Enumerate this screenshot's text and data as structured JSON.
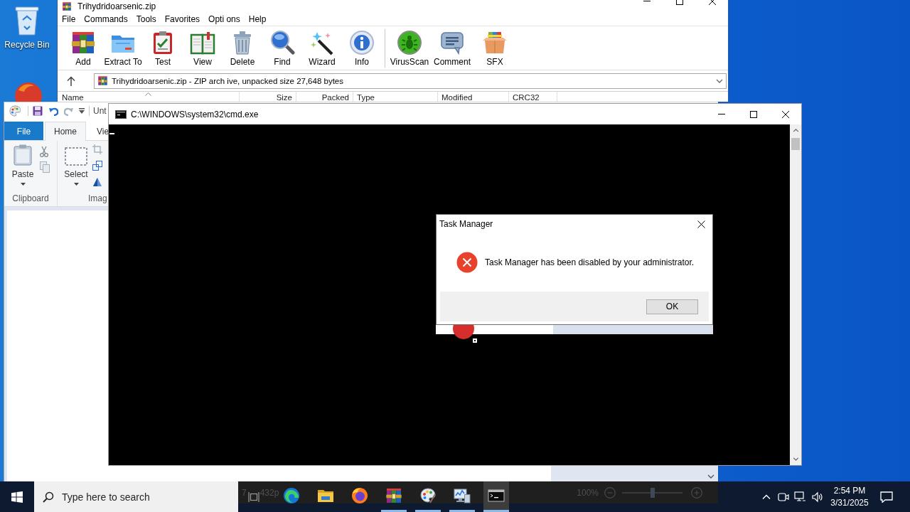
{
  "desktop": {
    "icons": [
      {
        "label": "Recycle Bin"
      }
    ]
  },
  "winrar": {
    "title": "Trihydridoarsenic.zip",
    "menu": [
      "File",
      "Commands",
      "Tools",
      "Favorites",
      "Opti ons",
      "Help"
    ],
    "toolbar": [
      {
        "buttons": [
          {
            "label": "Add"
          },
          {
            "label": "Extract To"
          },
          {
            "label": "Test"
          },
          {
            "label": "View"
          },
          {
            "label": "Delete"
          },
          {
            "label": "Find"
          },
          {
            "label": "Wizard"
          },
          {
            "label": "Info"
          }
        ]
      },
      {
        "buttons": [
          {
            "label": "VirusScan"
          },
          {
            "label": "Comment"
          },
          {
            "label": "SFX"
          }
        ]
      }
    ],
    "address": {
      "value": "Trihydridoarsenic.zip - ZIP arch ive, unpacked size 27,648 bytes"
    },
    "columns": [
      "Name",
      "Size",
      "Packed",
      "Type",
      "Modified",
      "CRC32"
    ]
  },
  "paint": {
    "title": "Unt",
    "tabs": [
      {
        "label": "File",
        "kind": "menu",
        "selected": false
      },
      {
        "label": "Home",
        "kind": "tab",
        "selected": true
      },
      {
        "label": "Vie",
        "kind": "tab",
        "selected": false
      }
    ],
    "groups": [
      {
        "label": "Clipboard",
        "tools": [
          "Paste"
        ]
      },
      {
        "label": "Imag",
        "tools": [
          "Select"
        ]
      }
    ],
    "status": {
      "fragments": [
        "7",
        "432p"
      ],
      "zoom": "100%",
      "zoom_slider": {
        "level": 0.5
      }
    }
  },
  "cmd": {
    "title": "C:\\WINDOWS\\system32\\cmd.exe"
  },
  "dialog": {
    "title": "Task Manager",
    "message": "Task Manager has been disabled by your administrator.",
    "buttons": [
      "OK"
    ]
  },
  "taskbar": {
    "search": {
      "placeholder": "Type here to search"
    },
    "apps": [
      {
        "running": false,
        "selected": false
      },
      {
        "running": false,
        "selected": false
      },
      {
        "running": false,
        "selected": false
      },
      {
        "running": true,
        "selected": false
      },
      {
        "running": true,
        "selected": false
      },
      {
        "running": true,
        "selected": false
      },
      {
        "running": true,
        "selected": true
      }
    ],
    "clock": {
      "time": "2:54 PM",
      "date": "3/31/2025"
    }
  }
}
